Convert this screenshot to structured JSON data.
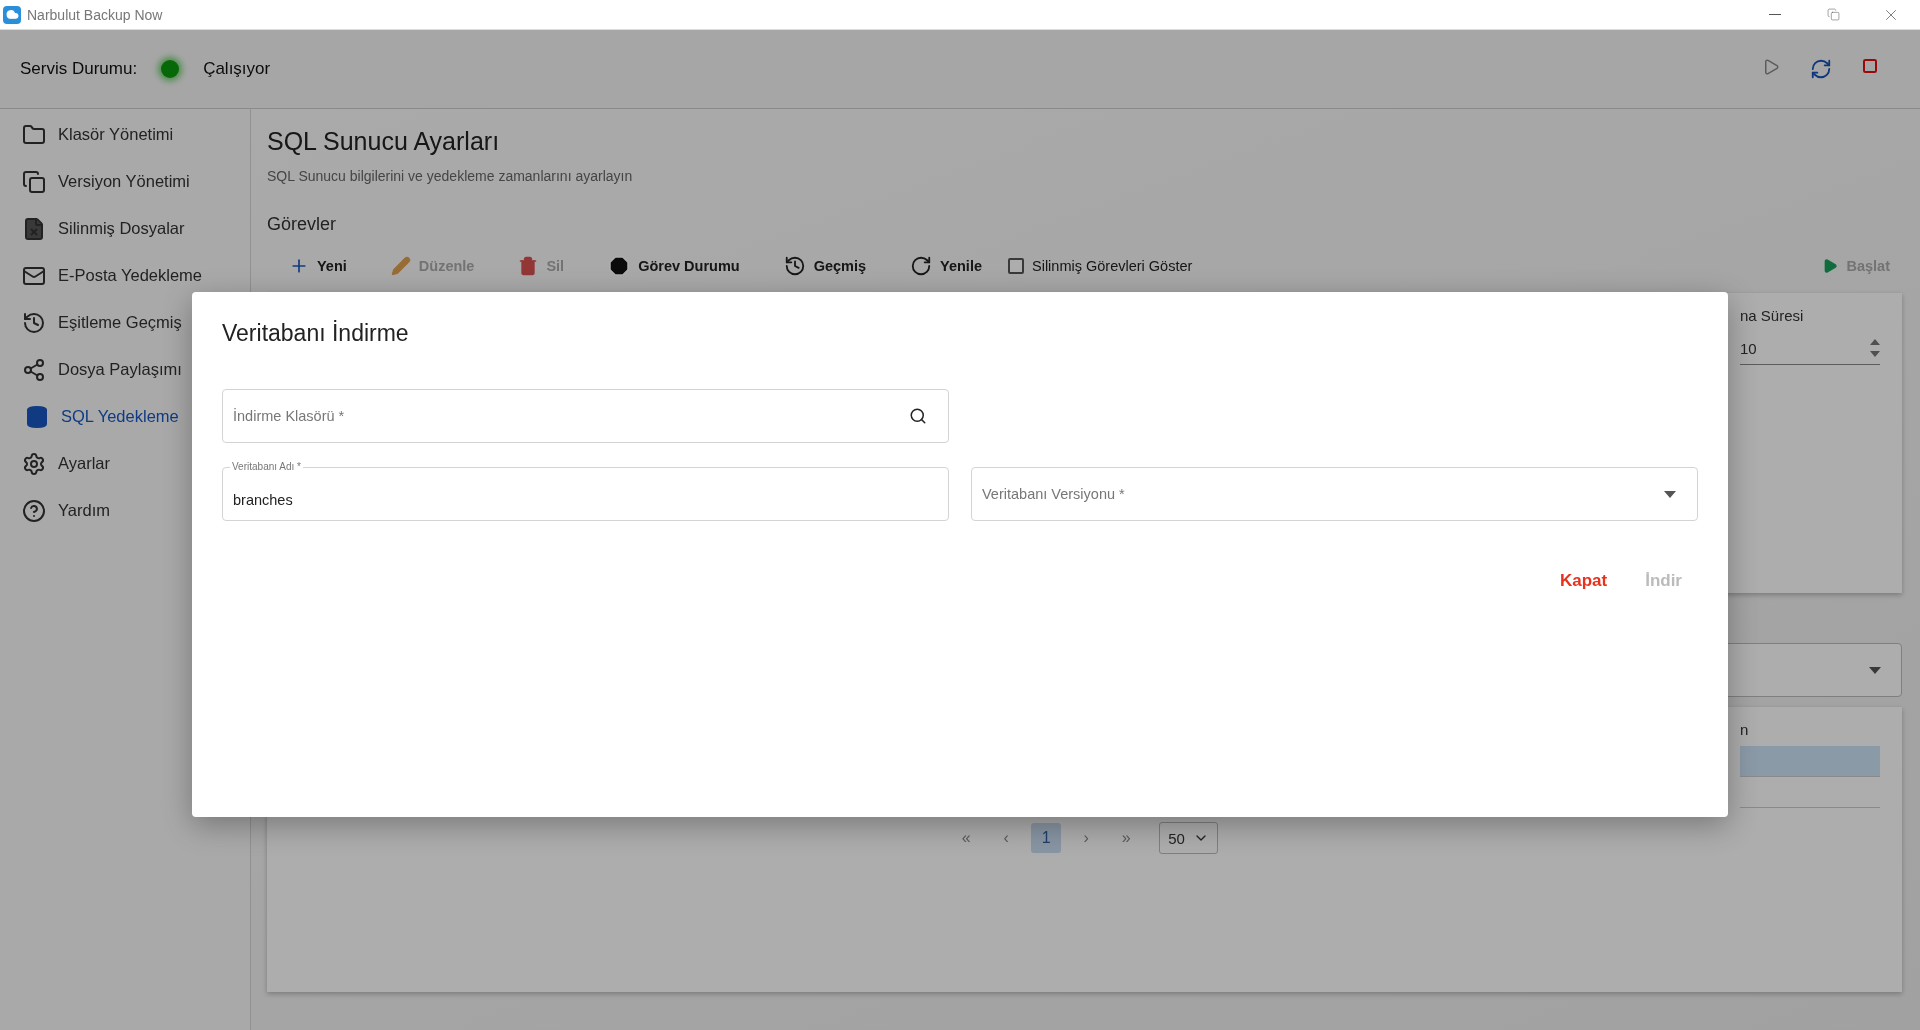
{
  "window": {
    "title": "Narbulut Backup Now"
  },
  "service": {
    "label": "Servis Durumu:",
    "status": "Çalışıyor",
    "running": true
  },
  "header_actions": [
    {
      "kind": "play",
      "disabled": true
    },
    {
      "kind": "refresh",
      "disabled": false
    },
    {
      "kind": "stop",
      "disabled": false
    }
  ],
  "sidebar": {
    "items": [
      {
        "kind": "folder",
        "label": "Klasör Yönetimi",
        "selected": false
      },
      {
        "kind": "versions",
        "label": "Versiyon Yönetimi",
        "selected": false
      },
      {
        "kind": "deleted",
        "label": "Silinmiş Dosyalar",
        "selected": false
      },
      {
        "kind": "mail",
        "label": "E-Posta Yedekleme",
        "selected": false
      },
      {
        "kind": "history",
        "label": "Eşitleme Geçmiş",
        "selected": false
      },
      {
        "kind": "share",
        "label": "Dosya Paylaşımı",
        "selected": false
      },
      {
        "kind": "database",
        "label": "SQL Yedekleme",
        "selected": true
      },
      {
        "kind": "settings",
        "label": "Ayarlar",
        "selected": false
      },
      {
        "kind": "help",
        "label": "Yardım",
        "selected": false
      }
    ]
  },
  "page": {
    "title": "SQL Sunucu Ayarları",
    "subtitle": "SQL Sunucu bilgilerini ve yedekleme zamanlarını ayarlayın"
  },
  "tasks": {
    "heading": "Görevler",
    "toolbar": [
      {
        "kind": "add",
        "label": "Yeni",
        "disabled": false
      },
      {
        "kind": "edit",
        "label": "Düzenle",
        "disabled": true
      },
      {
        "kind": "delete",
        "label": "Sil",
        "disabled": true
      },
      {
        "kind": "status",
        "label": "Görev Durumu",
        "disabled": false
      },
      {
        "kind": "history",
        "label": "Geçmiş",
        "disabled": false
      },
      {
        "kind": "refresh",
        "label": "Yenile",
        "disabled": false
      }
    ],
    "show_deleted": {
      "label": "Silinmiş Görevleri Göster",
      "checked": false
    },
    "start": {
      "label": "Başlat",
      "disabled": true
    },
    "table": {
      "column_header": "na Süresi",
      "value": "10"
    }
  },
  "history": {
    "column_header": "n",
    "rows": [
      {
        "selected": true
      },
      {
        "selected": false
      }
    ]
  },
  "pagination": {
    "first": "«",
    "prev": "‹",
    "pages": [
      {
        "label": "1",
        "selected": true
      }
    ],
    "next": "›",
    "last": "»",
    "page_size": "50"
  },
  "dialog": {
    "title": "Veritabanı İndirme",
    "folder_field": {
      "placeholder": "İndirme Klasörü *"
    },
    "name_field": {
      "label": "Veritabanı Adı *",
      "value": "branches"
    },
    "version_field": {
      "placeholder": "Veritabanı Versiyonu *"
    },
    "buttons": [
      {
        "kind": "cancel",
        "label": "Kapat",
        "disabled": false
      },
      {
        "kind": "confirm",
        "label": "İndir",
        "disabled": true
      }
    ]
  }
}
